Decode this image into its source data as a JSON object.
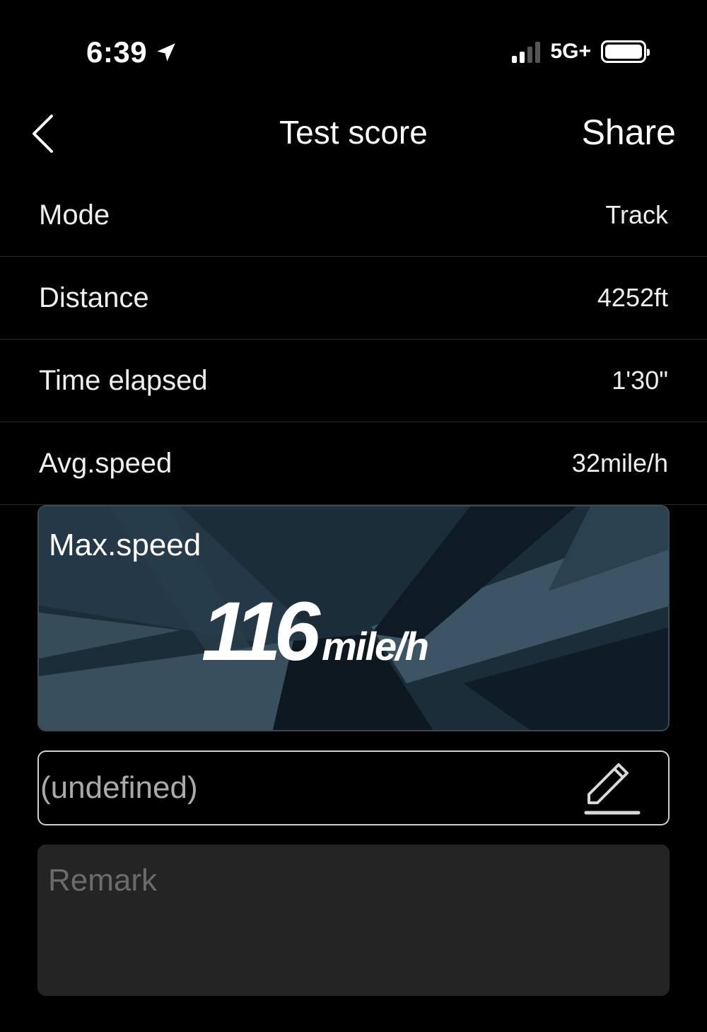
{
  "status_bar": {
    "time": "6:39",
    "network": "5G+",
    "signal_bars": 2,
    "battery_level": 1.0
  },
  "nav": {
    "title": "Test score",
    "share_label": "Share"
  },
  "stats": [
    {
      "label": "Mode",
      "value": "Track"
    },
    {
      "label": "Distance",
      "value": "4252ft"
    },
    {
      "label": "Time elapsed",
      "value": "1'30\""
    },
    {
      "label": "Avg.speed",
      "value": "32mile/h"
    }
  ],
  "max_speed": {
    "label": "Max.speed",
    "value": "116",
    "unit": "mile/h"
  },
  "name_field": {
    "value": "(undefined)"
  },
  "remark": {
    "placeholder": "Remark"
  },
  "colors": {
    "background": "#000000",
    "card": "#1b2b38",
    "remark_bg": "#242424"
  }
}
